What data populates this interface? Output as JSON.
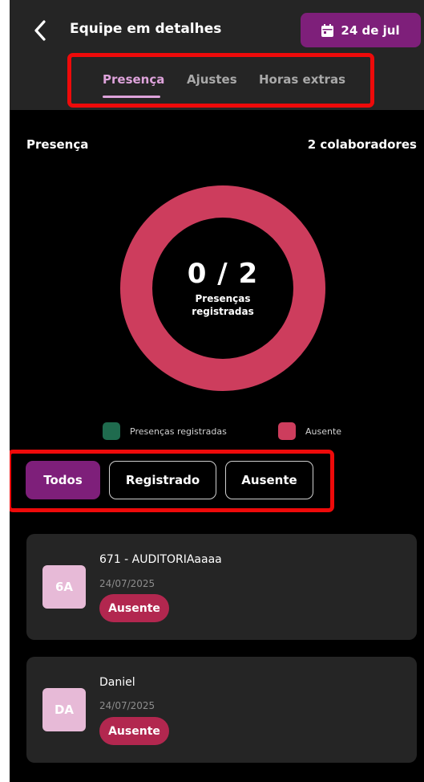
{
  "header": {
    "title": "Equipe em detalhes",
    "date_label": "24 de jul"
  },
  "tabs": [
    {
      "label": "Presença",
      "active": true
    },
    {
      "label": "Ajustes",
      "active": false
    },
    {
      "label": "Horas extras",
      "active": false
    }
  ],
  "summary": {
    "title": "Presença",
    "count_label": "2 colaboradores",
    "donut_value": "0 / 2",
    "donut_caption_line1": "Presenças",
    "donut_caption_line2": "registradas",
    "registered": 0,
    "total": 2
  },
  "legend": [
    {
      "label": "Presenças registradas",
      "color": "#1f6b4e"
    },
    {
      "label": "Ausente",
      "color": "#cd3d5d"
    }
  ],
  "filters": [
    {
      "label": "Todos",
      "selected": true
    },
    {
      "label": "Registrado",
      "selected": false
    },
    {
      "label": "Ausente",
      "selected": false
    }
  ],
  "employees": [
    {
      "initials": "6A",
      "name": "671 - AUDITORIAaaaa",
      "date": "24/07/2025",
      "status": "Ausente"
    },
    {
      "initials": "DA",
      "name": "Daniel",
      "date": "24/07/2025",
      "status": "Ausente"
    }
  ],
  "colors": {
    "accent": "#7e1f7a",
    "tab_active": "#dea3db",
    "absent": "#cd3d5d",
    "badge": "#b2274f",
    "highlight_border": "#ee0a0a"
  }
}
